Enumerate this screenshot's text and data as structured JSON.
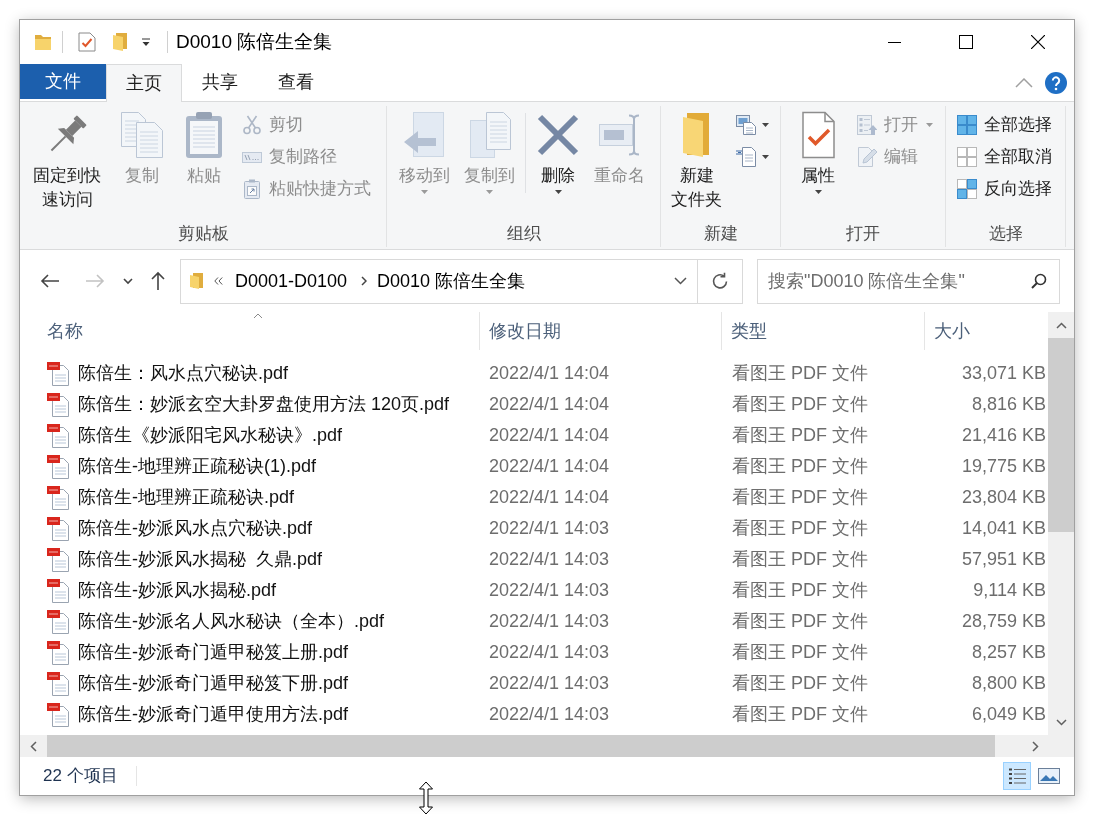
{
  "title_bar": {
    "title": "D0010 陈倍生全集"
  },
  "ribbon_tabs": [
    {
      "label": "文件",
      "kind": "file",
      "selected": false
    },
    {
      "label": "主页",
      "kind": "tab",
      "selected": true
    },
    {
      "label": "共享",
      "kind": "tab",
      "selected": false
    },
    {
      "label": "查看",
      "kind": "tab",
      "selected": false
    }
  ],
  "ribbon_groups": [
    {
      "label": "剪贴板",
      "buttons": [
        {
          "label": "固定到快速访问",
          "kind": "large",
          "disabled": false,
          "dropdown": false
        },
        {
          "label": "复制",
          "kind": "large",
          "disabled": true,
          "dropdown": false
        },
        {
          "label": "粘贴",
          "kind": "large",
          "disabled": true,
          "dropdown": false
        },
        {
          "label": "剪切",
          "kind": "small",
          "disabled": true,
          "dropdown": false
        },
        {
          "label": "复制路径",
          "kind": "small",
          "disabled": true,
          "dropdown": false
        },
        {
          "label": "粘贴快捷方式",
          "kind": "small",
          "disabled": true,
          "dropdown": false
        }
      ]
    },
    {
      "label": "组织",
      "buttons": [
        {
          "label": "移动到",
          "kind": "large",
          "disabled": true,
          "dropdown": true
        },
        {
          "label": "复制到",
          "kind": "large",
          "disabled": true,
          "dropdown": true
        },
        {
          "label": "删除",
          "kind": "large",
          "disabled": false,
          "dropdown": true
        },
        {
          "label": "重命名",
          "kind": "large",
          "disabled": true,
          "dropdown": false
        }
      ]
    },
    {
      "label": "新建",
      "buttons": [
        {
          "label": "新建文件夹",
          "kind": "large",
          "disabled": false,
          "dropdown": false
        },
        {
          "kind": "icon",
          "disabled": false,
          "dropdown": true
        },
        {
          "kind": "icon",
          "disabled": false,
          "dropdown": true
        }
      ]
    },
    {
      "label": "打开",
      "buttons": [
        {
          "label": "属性",
          "kind": "large",
          "disabled": false,
          "dropdown": true
        },
        {
          "label": "打开",
          "kind": "small",
          "disabled": true,
          "dropdown": true
        },
        {
          "label": "编辑",
          "kind": "small",
          "disabled": true,
          "dropdown": false
        }
      ]
    },
    {
      "label": "选择",
      "buttons": [
        {
          "label": "全部选择",
          "kind": "small",
          "disabled": false,
          "dropdown": false
        },
        {
          "label": "全部取消",
          "kind": "small",
          "disabled": false,
          "dropdown": false
        },
        {
          "label": "反向选择",
          "kind": "small",
          "disabled": false,
          "dropdown": false
        }
      ]
    }
  ],
  "navigation": [
    {
      "disabled": false
    },
    {
      "disabled": true
    },
    {
      "disabled": false
    },
    {
      "disabled": false
    }
  ],
  "address_bar": {
    "breadcrumbs": [
      "D0001-D0100",
      "D0010 陈倍生全集"
    ]
  },
  "search": {
    "placeholder": "搜索\"D0010 陈倍生全集\""
  },
  "columns": [
    {
      "label": "名称",
      "sorted": true
    },
    {
      "label": "修改日期",
      "sorted": false
    },
    {
      "label": "类型",
      "sorted": false
    },
    {
      "label": "大小",
      "sorted": false
    }
  ],
  "files": [
    {
      "name": "陈倍生：风水点穴秘诀.pdf",
      "modified": "2022/4/1 14:04",
      "type": "看图王 PDF 文件",
      "size": "33,071 KB"
    },
    {
      "name": "陈倍生：妙派玄空大卦罗盘使用方法 120页.pdf",
      "modified": "2022/4/1 14:04",
      "type": "看图王 PDF 文件",
      "size": "8,816 KB"
    },
    {
      "name": "陈倍生《妙派阳宅风水秘诀》.pdf",
      "modified": "2022/4/1 14:04",
      "type": "看图王 PDF 文件",
      "size": "21,416 KB"
    },
    {
      "name": "陈倍生-地理辨正疏秘诀(1).pdf",
      "modified": "2022/4/1 14:04",
      "type": "看图王 PDF 文件",
      "size": "19,775 KB"
    },
    {
      "name": "陈倍生-地理辨正疏秘诀.pdf",
      "modified": "2022/4/1 14:04",
      "type": "看图王 PDF 文件",
      "size": "23,804 KB"
    },
    {
      "name": "陈倍生-妙派风水点穴秘诀.pdf",
      "modified": "2022/4/1 14:03",
      "type": "看图王 PDF 文件",
      "size": "14,041 KB"
    },
    {
      "name": "陈倍生-妙派风水揭秘  久鼎.pdf",
      "modified": "2022/4/1 14:03",
      "type": "看图王 PDF 文件",
      "size": "57,951 KB"
    },
    {
      "name": "陈倍生-妙派风水揭秘.pdf",
      "modified": "2022/4/1 14:03",
      "type": "看图王 PDF 文件",
      "size": "9,114 KB"
    },
    {
      "name": "陈倍生-妙派名人风水秘诀（全本）.pdf",
      "modified": "2022/4/1 14:03",
      "type": "看图王 PDF 文件",
      "size": "28,759 KB"
    },
    {
      "name": "陈倍生-妙派奇门遁甲秘笈上册.pdf",
      "modified": "2022/4/1 14:03",
      "type": "看图王 PDF 文件",
      "size": "8,257 KB"
    },
    {
      "name": "陈倍生-妙派奇门遁甲秘笈下册.pdf",
      "modified": "2022/4/1 14:03",
      "type": "看图王 PDF 文件",
      "size": "8,800 KB"
    },
    {
      "name": "陈倍生-妙派奇门遁甲使用方法.pdf",
      "modified": "2022/4/1 14:03",
      "type": "看图王 PDF 文件",
      "size": "6,049 KB"
    }
  ],
  "status_bar": {
    "item_count": "22 个项目"
  },
  "view_buttons": [
    {
      "selected": true
    },
    {
      "selected": false
    }
  ]
}
